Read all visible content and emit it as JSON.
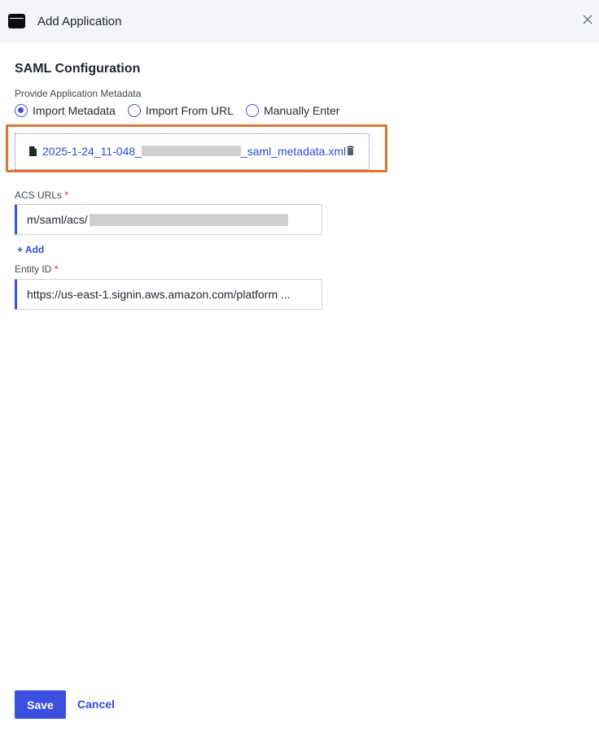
{
  "header": {
    "title": "Add Application",
    "icon": "window-icon",
    "close_icon": "close-icon"
  },
  "saml": {
    "title": "SAML Configuration",
    "metadata_label": "Provide Application Metadata",
    "options": [
      {
        "label": "Import Metadata",
        "selected": true
      },
      {
        "label": "Import From URL",
        "selected": false
      },
      {
        "label": "Manually Enter",
        "selected": false
      }
    ],
    "file": {
      "name_prefix": "2025-1-24_11-048_",
      "name_suffix": "_saml_metadata.xml",
      "file_icon": "file-icon",
      "delete_icon": "trash-icon"
    }
  },
  "acs": {
    "label": "ACS URLs",
    "required_mark": "*",
    "value": "m/saml/acs/",
    "add_label": "+ Add"
  },
  "entity": {
    "label": "Entity ID",
    "required_mark": "*",
    "value": "https://us-east-1.signin.aws.amazon.com/platform ..."
  },
  "footer": {
    "save_label": "Save",
    "cancel_label": "Cancel"
  },
  "colors": {
    "accent": "#3b4fe0",
    "highlight": "#e0742f",
    "required": "#c62828",
    "header_bg": "#f4f5f9"
  }
}
